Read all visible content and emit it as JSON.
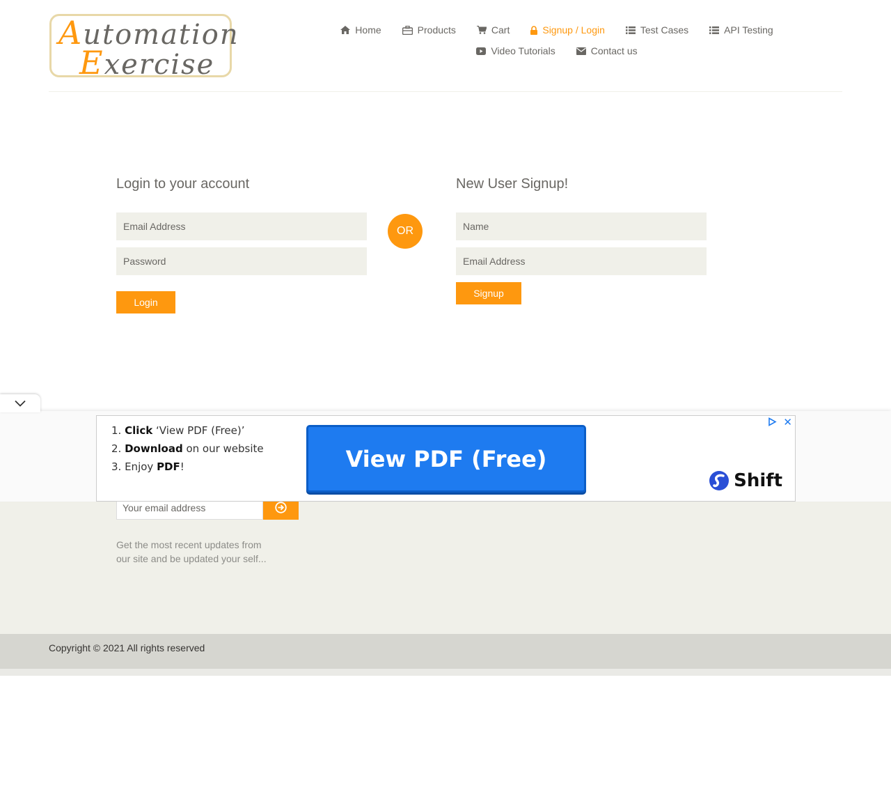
{
  "logo": {
    "line1_cap": "A",
    "line1_rest": "utomation",
    "line2_cap": "E",
    "line2_rest": "xercise"
  },
  "nav": {
    "items": [
      {
        "label": "Home",
        "icon": "home-icon"
      },
      {
        "label": "Products",
        "icon": "briefcase-icon"
      },
      {
        "label": "Cart",
        "icon": "cart-icon"
      },
      {
        "label": "Signup / Login",
        "icon": "lock-icon",
        "active": true
      },
      {
        "label": "Test Cases",
        "icon": "list-icon"
      },
      {
        "label": "API Testing",
        "icon": "list-icon"
      },
      {
        "label": "Video Tutorials",
        "icon": "youtube-play-icon"
      },
      {
        "label": "Contact us",
        "icon": "envelope-icon"
      }
    ]
  },
  "login": {
    "title": "Login to your account",
    "email_placeholder": "Email Address",
    "password_placeholder": "Password",
    "button": "Login"
  },
  "or_label": "OR",
  "signup": {
    "title": "New User Signup!",
    "name_placeholder": "Name",
    "email_placeholder": "Email Address",
    "button": "Signup"
  },
  "subscription": {
    "email_placeholder": "Your email address",
    "text": "Get the most recent updates from our site and be updated your self..."
  },
  "footer": {
    "copyright": "Copyright © 2021 All rights reserved"
  },
  "ad": {
    "step1_num": "1.",
    "step1_bold": "Click",
    "step1_rest": " ‘View PDF (Free)’",
    "step2_num": "2.",
    "step2_bold": "Download",
    "step2_rest": " on our website",
    "step3_num": "3.",
    "step3_pre": " Enjoy ",
    "step3_bold": "PDF",
    "step3_rest": "!",
    "cta": "View PDF (Free)",
    "brand": "Shift",
    "close": "✕"
  },
  "colors": {
    "accent": "#fe980f",
    "text": "#696763",
    "input_bg": "#f0f0e9",
    "ad_blue": "#1e7bf0"
  }
}
